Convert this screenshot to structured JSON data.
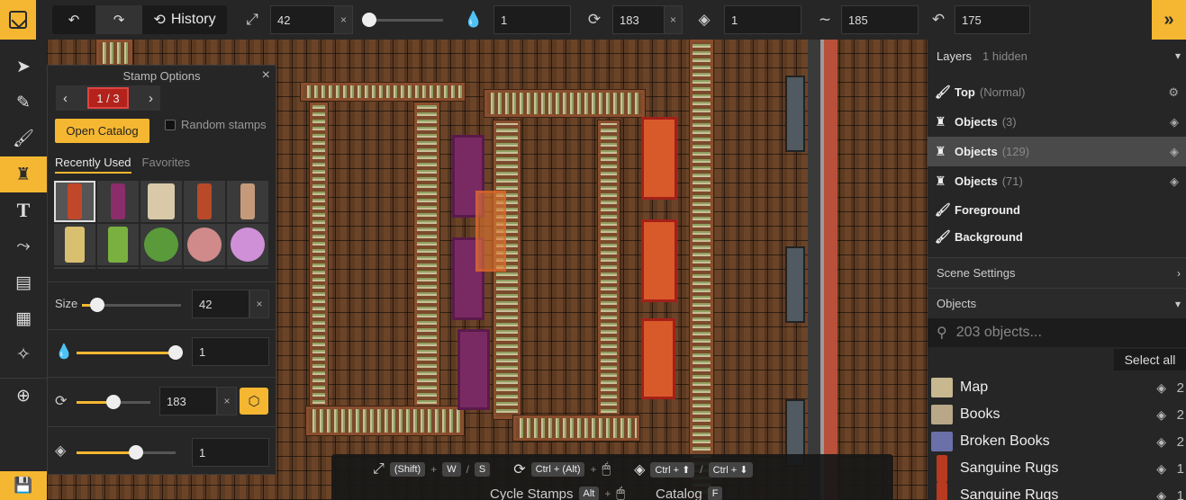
{
  "toolbar": {
    "undo_icon": "↶",
    "redo_icon": "↷",
    "history_label": "History",
    "size_value": "42",
    "opacity_value": "1",
    "rotation_value": "183",
    "layer_value": "1",
    "curve_value": "185",
    "angle_value": "175",
    "clear_symbol": "×",
    "expand_icon": "»"
  },
  "stamp_panel": {
    "title": "Stamp Options",
    "close_symbol": "×",
    "page_indicator": "1 / 3",
    "open_catalog_label": "Open Catalog",
    "random_label": "Random stamps",
    "tabs": [
      {
        "label": "Recently Used",
        "active": true
      },
      {
        "label": "Favorites",
        "active": false
      }
    ],
    "stamps": [
      {
        "name": "red-rug",
        "color": "#c0472a"
      },
      {
        "name": "purple-rug",
        "color": "#8a2d6a"
      },
      {
        "name": "fur-rug",
        "color": "#d9c9a8"
      },
      {
        "name": "sanguine-rug",
        "color": "#b84a2a"
      },
      {
        "name": "books",
        "color": "#c49a7a"
      },
      {
        "name": "yellow-curtain",
        "color": "#d8c070"
      },
      {
        "name": "green-curtain",
        "color": "#7ab040"
      },
      {
        "name": "green-cushion",
        "color": "#5a9a3a"
      },
      {
        "name": "pink-cushion",
        "color": "#d08a8a"
      },
      {
        "name": "violet-cushion",
        "color": "#d090d8"
      }
    ],
    "size_label": "Size",
    "size_value": "42",
    "opacity_value": "1",
    "rotation_value": "183",
    "layer_value": "1",
    "size_level": 0.15,
    "opacity_level": 1.0,
    "rotation_level": 0.5,
    "layer_level": 0.6,
    "clear_symbol": "×"
  },
  "shortcuts": {
    "row1": [
      "Shift",
      "W",
      "S",
      "Ctrl + (Alt)",
      "Ctrl + ⬆",
      "Ctrl + ⬇"
    ],
    "row2_label1": "Cycle Stamps",
    "row2_key1": "Alt",
    "row2_label2": "Catalog",
    "row2_key2": "F"
  },
  "right_panel": {
    "layers_title": "Layers",
    "hidden_count": "1 hidden",
    "layers": [
      {
        "name": "Top",
        "count": "(Normal)",
        "type": "brush"
      },
      {
        "name": "Objects",
        "count": "(3)",
        "type": "tower"
      },
      {
        "name": "Objects",
        "count": "(129)",
        "type": "tower",
        "selected": true
      },
      {
        "name": "Objects",
        "count": "(71)",
        "type": "tower"
      },
      {
        "name": "Foreground",
        "count": "",
        "type": "brush"
      },
      {
        "name": "Background",
        "count": "",
        "type": "brush"
      }
    ],
    "scene_settings_label": "Scene Settings",
    "objects_label": "Objects",
    "search_placeholder": "203 objects...",
    "select_all_label": "Select all",
    "objects": [
      {
        "name": "Map",
        "count": "2",
        "color": "#c8b890"
      },
      {
        "name": "Books",
        "count": "2",
        "color": "#b8a888"
      },
      {
        "name": "Broken Books",
        "count": "2",
        "color": "#6a70a8"
      },
      {
        "name": "Sanguine Rugs",
        "count": "1",
        "color": "#b83a20"
      },
      {
        "name": "Sanguine Rugs",
        "count": "1",
        "color": "#b83a20"
      }
    ]
  },
  "colors": {
    "accent": "#f5b731",
    "panel_bg": "#262626",
    "selected_layer_bg": "#4a4a4a"
  }
}
